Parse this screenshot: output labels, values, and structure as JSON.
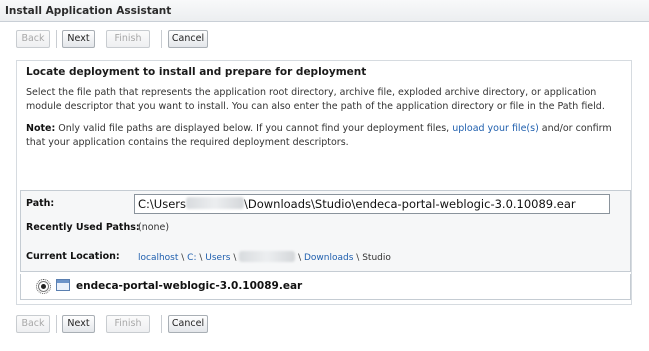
{
  "title": "Install Application Assistant",
  "buttons": {
    "back": "Back",
    "next": "Next",
    "finish": "Finish",
    "cancel": "Cancel"
  },
  "heading": "Locate deployment to install and prepare for deployment",
  "description": "Select the file path that represents the application root directory, archive file, exploded archive directory, or application module descriptor that you want to install. You can also enter the path of the application directory or file in the Path field.",
  "note": {
    "label": "Note:",
    "text_before": " Only valid file paths are displayed below. If you cannot find your deployment files, ",
    "link": "upload your file(s)",
    "text_after": " and/or confirm that your application contains the required deployment descriptors."
  },
  "path": {
    "label": "Path:",
    "value_prefix": "C:\\Users",
    "value_suffix": "\\Downloads\\Studio\\endeca-portal-weblogic-3.0.10089.ear"
  },
  "recent": {
    "label": "Recently Used Paths:",
    "value": "(none)"
  },
  "current": {
    "label": "Current Location:",
    "crumbs": [
      "localhost",
      "C:",
      "Users",
      "",
      "Downloads",
      "Studio"
    ],
    "sep": " \\ "
  },
  "file": {
    "name": "endeca-portal-weblogic-3.0.10089.ear",
    "selected": true,
    "icon": "application-archive-icon"
  }
}
